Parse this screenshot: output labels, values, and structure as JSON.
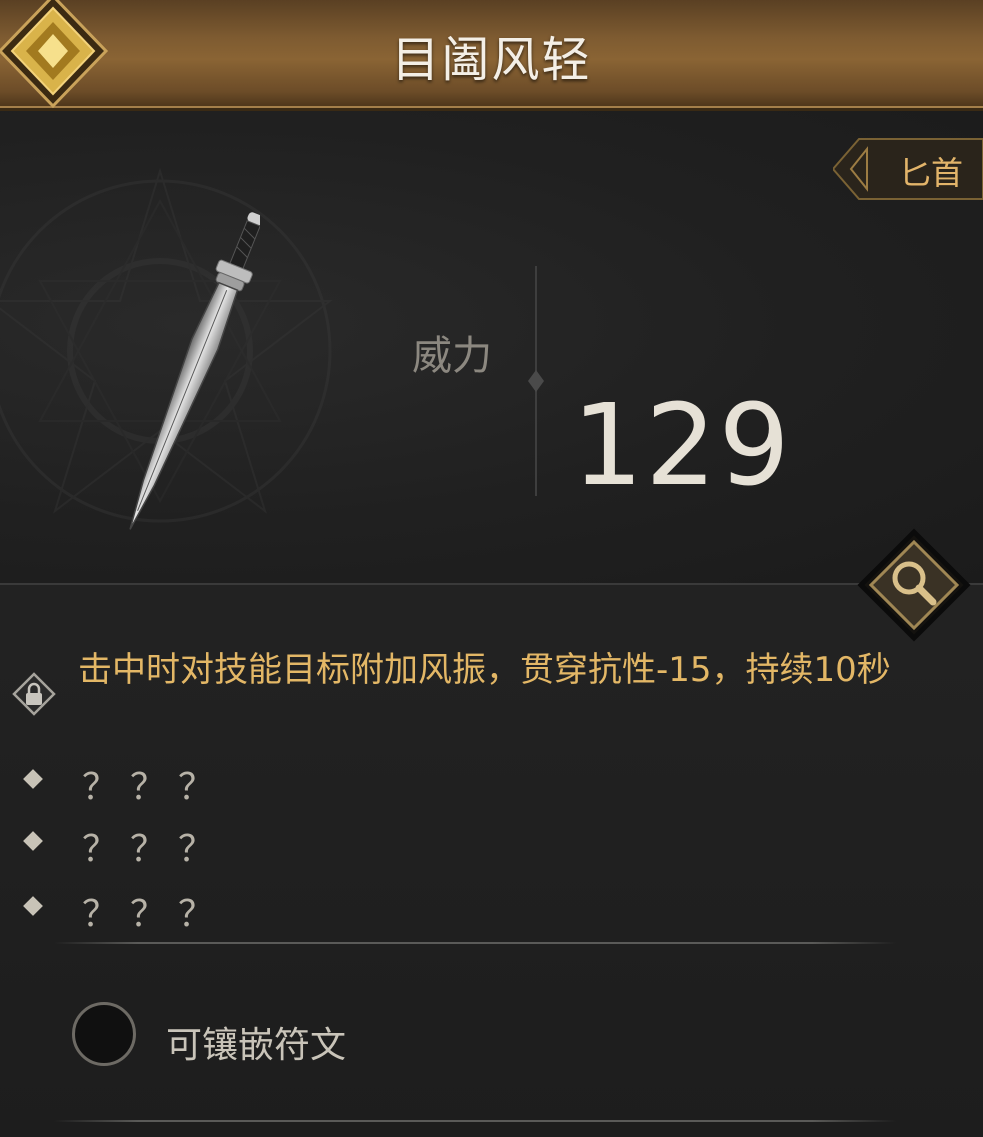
{
  "header": {
    "title": "目阖风轻"
  },
  "weapon": {
    "type_label": "匕首",
    "icon": "dagger-icon"
  },
  "stats": {
    "power_label": "威力",
    "power_value": "129"
  },
  "affixes": {
    "locked_text": "击中时对技能目标附加风振，贯穿抗性-15，持续10秒",
    "unknown": [
      "？？？",
      "？？？",
      "？？？"
    ]
  },
  "rune": {
    "label": "可镶嵌符文"
  },
  "colors": {
    "accent_gold": "#e3b766",
    "header_bronze": "#7e5b31",
    "power_text": "#e6e1d6"
  }
}
